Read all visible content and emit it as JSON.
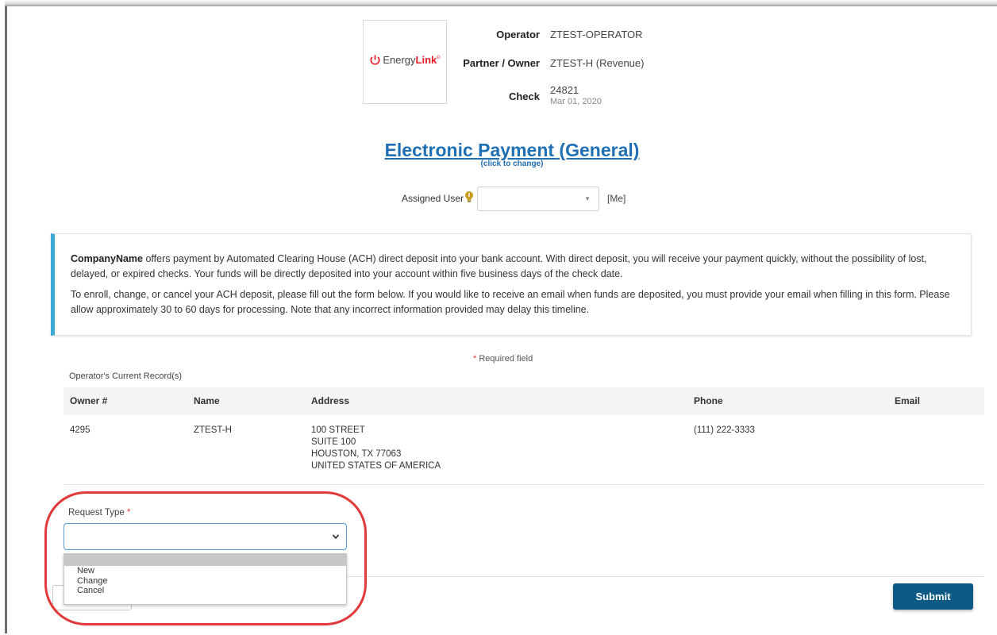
{
  "header": {
    "logo_text_a": "Energy",
    "logo_text_b": "Link",
    "operator_label": "Operator",
    "operator_value": "ZTEST-OPERATOR",
    "partner_label": "Partner / Owner",
    "partner_value": "ZTEST-H (Revenue)",
    "check_label": "Check",
    "check_number": "24821",
    "check_date": "Mar 01, 2020"
  },
  "title": {
    "text": "Electronic Payment (General)",
    "change_hint": "(click to change)"
  },
  "assigned_user": {
    "label": "Assigned User",
    "value": "",
    "me_link": "[Me]"
  },
  "info": {
    "p1_company": "CompanyName",
    "p1_text": " offers payment by Automated Clearing House (ACH) direct deposit into your bank account. With direct deposit, you will receive your payment quickly, without the possibility of lost, delayed, or expired checks. Your funds will be directly deposited into your account within five business days of the check date.",
    "p2_text": "To enroll, change, or cancel your ACH deposit, please fill out the form below. If you would like to receive an email when funds are deposited, you must provide your email when filling in this form. Please allow approximately 30 to 60 days for processing. Note that any incorrect information provided may delay this timeline."
  },
  "required_note": {
    "star": "*",
    "text": " Required field"
  },
  "records": {
    "label": "Operator's Current Record(s)",
    "columns": [
      "Owner #",
      "Name",
      "Address",
      "Phone",
      "Email"
    ],
    "rows": [
      {
        "owner": "4295",
        "name": "ZTEST-H",
        "address": [
          "100 STREET",
          "SUITE 100",
          "HOUSTON, TX  77063",
          "UNITED STATES OF AMERICA"
        ],
        "phone": "(111) 222-3333",
        "email": ""
      }
    ]
  },
  "request_type": {
    "label": "Request Type",
    "star": "*",
    "value": "",
    "options": [
      "New",
      "Change",
      "Cancel"
    ]
  },
  "buttons": {
    "submit": "Submit"
  },
  "colors": {
    "accent_blue": "#1f6fb5",
    "info_border": "#3aa9d8",
    "submit_bg": "#0d5a87",
    "highlight_red": "#e03a3a",
    "brand_red": "#e31d2c"
  }
}
